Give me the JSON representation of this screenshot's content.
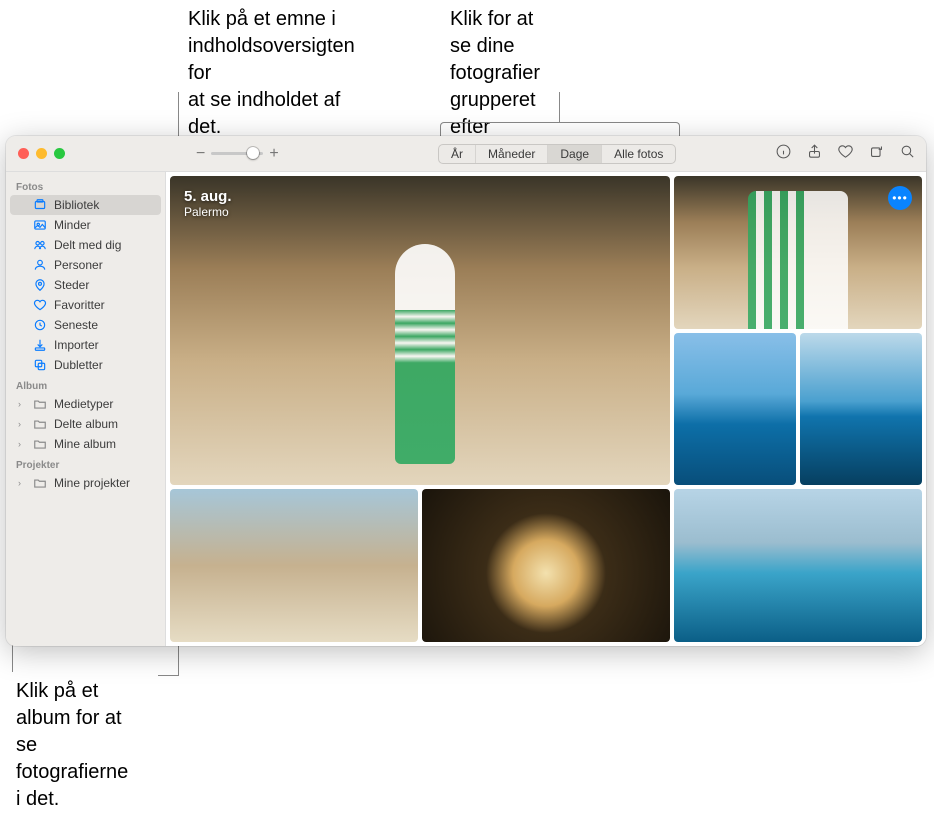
{
  "callouts": {
    "left": "Klik på et emne i\nindholdsoversigten for\nat se indholdet af det.",
    "right": "Klik for at se dine\nfotografier grupperet efter\ndage, måneder eller år.",
    "bottom": "Klik på et album for at se\nfotografierne i det."
  },
  "toolbar": {
    "zoom_out": "−",
    "zoom_in": "+",
    "segments": [
      "År",
      "Måneder",
      "Dage",
      "Alle fotos"
    ],
    "active_segment": 2
  },
  "sidebar": {
    "sections": [
      {
        "header": "Fotos",
        "items": [
          {
            "label": "Bibliotek",
            "icon": "library",
            "selected": true
          },
          {
            "label": "Minder",
            "icon": "memories"
          },
          {
            "label": "Delt med dig",
            "icon": "shared"
          },
          {
            "label": "Personer",
            "icon": "people"
          },
          {
            "label": "Steder",
            "icon": "places"
          },
          {
            "label": "Favoritter",
            "icon": "heart"
          },
          {
            "label": "Seneste",
            "icon": "clock"
          },
          {
            "label": "Importer",
            "icon": "import"
          },
          {
            "label": "Dubletter",
            "icon": "duplicates"
          }
        ]
      },
      {
        "header": "Album",
        "items": [
          {
            "label": "Medietyper",
            "icon": "folder",
            "disclosure": true
          },
          {
            "label": "Delte album",
            "icon": "folder",
            "disclosure": true
          },
          {
            "label": "Mine album",
            "icon": "folder",
            "disclosure": true
          }
        ]
      },
      {
        "header": "Projekter",
        "items": [
          {
            "label": "Mine projekter",
            "icon": "folder",
            "disclosure": true
          }
        ]
      }
    ]
  },
  "content": {
    "date_label": "5. aug.",
    "location_label": "Palermo",
    "more_label": "•••"
  }
}
